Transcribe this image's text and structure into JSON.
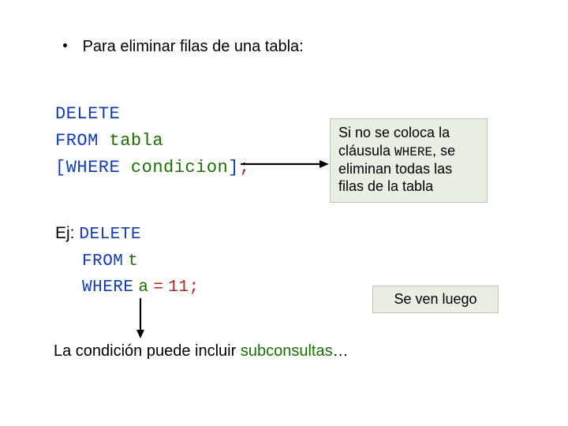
{
  "bullet": {
    "text": "Para eliminar filas de una tabla:"
  },
  "syntax": {
    "delete_kw": "DELETE",
    "from_kw": "FROM",
    "table_ident": "tabla",
    "where_open": "[WHERE",
    "cond_ident": "condicion",
    "close_bracket": "]",
    "semicolon": ";"
  },
  "note1": {
    "prefix": "Si no se coloca la cláusula ",
    "where_mono": "WHERE",
    "suffix": ", se eliminan todas las filas de la tabla"
  },
  "example": {
    "ej_label": "Ej:",
    "delete_kw": "DELETE",
    "from_kw": "FROM",
    "t_ident": "t",
    "where_kw": "WHERE",
    "a_ident": "a",
    "eq": "=",
    "eleven": "11",
    "semicolon": ";"
  },
  "note2": {
    "text": "Se ven luego"
  },
  "bottom": {
    "prefix": "La condición puede incluir ",
    "subq": "subconsultas",
    "suffix": "…"
  }
}
